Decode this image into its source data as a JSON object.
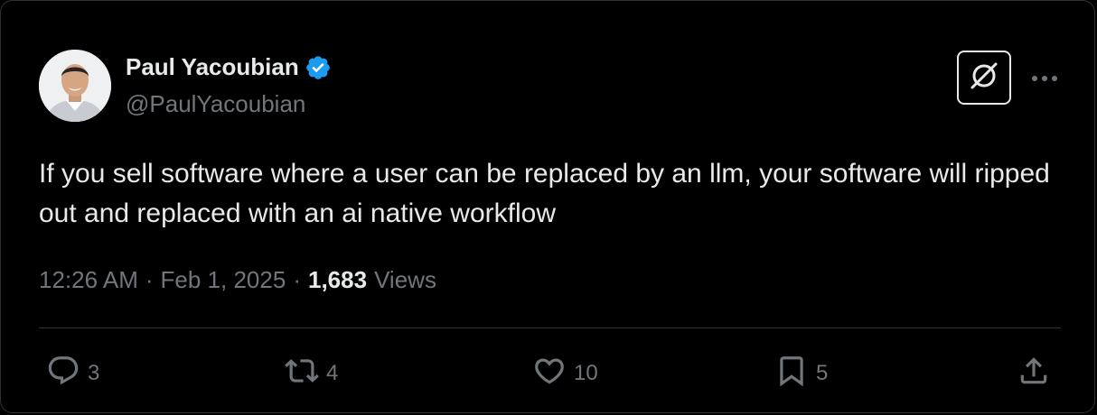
{
  "author": {
    "display_name": "Paul Yacoubian",
    "handle": "@PaulYacoubian",
    "verified": true
  },
  "tweet": {
    "text": "If you sell software where a user can be replaced by an llm, your software will ripped out and replaced with an ai native workflow",
    "time": "12:26 AM",
    "separator": "·",
    "date": "Feb 1, 2025",
    "views_count": "1,683",
    "views_label": "Views"
  },
  "actions": {
    "replies": "3",
    "reposts": "4",
    "likes": "10",
    "bookmarks": "5"
  },
  "colors": {
    "background": "#000000",
    "text": "#e7e9ea",
    "secondary": "#71767b",
    "border": "#2f3336",
    "verified": "#1d9bf0"
  },
  "icons": [
    "avatar",
    "verified-badge-icon",
    "grok-icon",
    "more-icon",
    "reply-icon",
    "repost-icon",
    "like-icon",
    "bookmark-icon",
    "share-icon"
  ]
}
